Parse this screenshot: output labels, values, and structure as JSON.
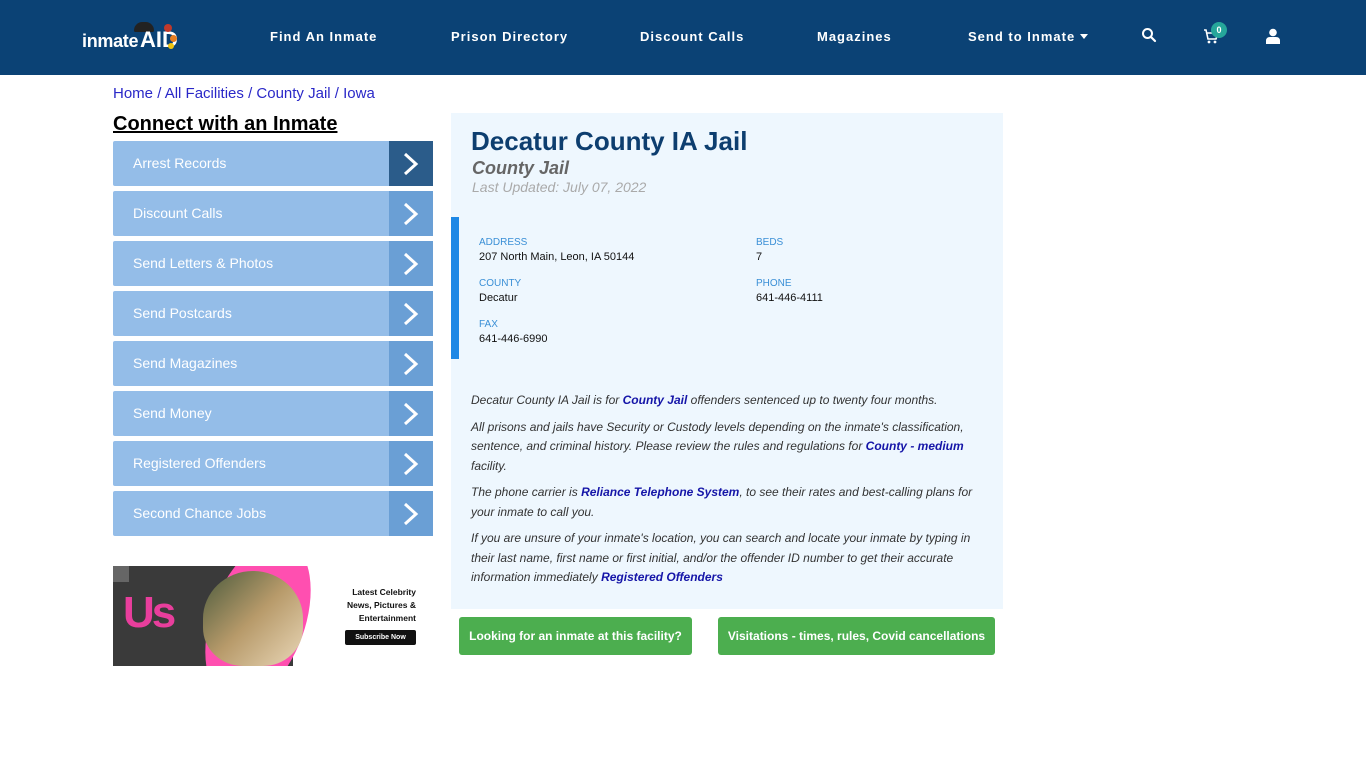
{
  "header": {
    "logo": {
      "text": "inmate",
      "accent": "AID"
    },
    "nav": [
      {
        "label": "Find An Inmate"
      },
      {
        "label": "Prison Directory"
      },
      {
        "label": "Discount Calls"
      },
      {
        "label": "Magazines"
      },
      {
        "label": "Send to Inmate"
      }
    ],
    "cart_count": "0",
    "icons": [
      "search-icon",
      "cart-icon",
      "user-icon"
    ]
  },
  "breadcrumb": [
    {
      "label": "Home"
    },
    {
      "label": "All Facilities"
    },
    {
      "label": "County Jail"
    },
    {
      "label": "Iowa"
    }
  ],
  "breadcrumb_sep": "/",
  "sidebar": {
    "title": "Connect with an Inmate",
    "items": [
      {
        "label": "Arrest Records"
      },
      {
        "label": "Discount Calls"
      },
      {
        "label": "Send Letters & Photos"
      },
      {
        "label": "Send Postcards"
      },
      {
        "label": "Send Magazines"
      },
      {
        "label": "Send Money"
      },
      {
        "label": "Registered Offenders"
      },
      {
        "label": "Second Chance Jobs"
      }
    ],
    "ad": {
      "brand": "Us",
      "line1": "Latest Celebrity",
      "line2": "News, Pictures &",
      "line3": "Entertainment",
      "cta": "Subscribe Now"
    }
  },
  "facility": {
    "name": "Decatur County IA Jail",
    "type": "County Jail",
    "last_updated": "Last Updated: July 07, 2022",
    "info": {
      "address_label": "ADDRESS",
      "address": "207 North Main, Leon, IA 50144",
      "beds_label": "BEDS",
      "beds": "7",
      "county_label": "COUNTY",
      "county": "Decatur",
      "phone_label": "PHONE",
      "phone": "641-446-4111",
      "fax_label": "FAX",
      "fax": "641-446-6990"
    },
    "description": {
      "p1_pre": "Decatur County IA Jail is for ",
      "p1_link": "County Jail",
      "p1_post": " offenders sentenced up to twenty four months.",
      "p2_pre": "All prisons and jails have Security or Custody levels depending on the inmate's classification, sentence, and criminal history. Please review the rules and regulations for ",
      "p2_link": "County - medium",
      "p2_post": " facility.",
      "p3_pre": "The phone carrier is ",
      "p3_link": "Reliance Telephone System",
      "p3_post": ", to see their rates and best-calling plans for your inmate to call you.",
      "p4_pre": "If you are unsure of your inmate's location, you can search and locate your inmate by typing in their last name, first name or first initial, and/or the offender ID number to get their accurate information immediately ",
      "p4_link": "Registered Offenders"
    }
  },
  "buttons": {
    "find_inmate": "Looking for an inmate at this facility?",
    "visitations": "Visitations - times, rules, Covid cancellations"
  },
  "colors": {
    "header_bg": "#0b4275",
    "sidebar_item": "#94bde8",
    "sidebar_arrow": "#6a9fd5",
    "panel_bg": "#eef7fe",
    "title": "#0d3e6f",
    "accent_bar": "#1e88e5",
    "green_button": "#4cae4f"
  }
}
